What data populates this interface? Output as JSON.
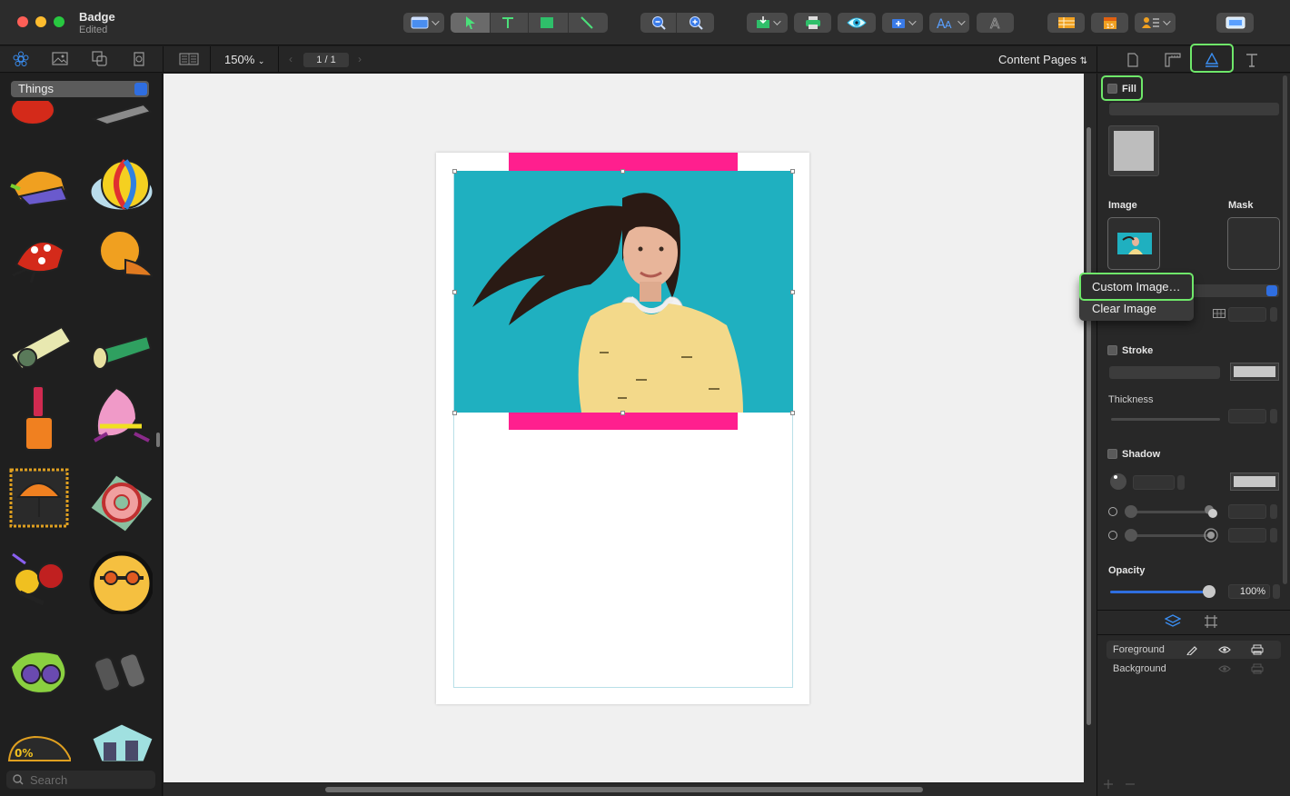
{
  "window": {
    "title": "Badge",
    "subtitle": "Edited"
  },
  "toolbar": {
    "zoom": "150%",
    "page_indicator": "1 / 1",
    "content_pages": "Content Pages"
  },
  "library": {
    "category": "Things",
    "search_placeholder": "Search"
  },
  "inspector": {
    "fill_label": "Fill",
    "image_label": "Image",
    "mask_label": "Mask",
    "stroke_label": "Stroke",
    "thickness_label": "Thickness",
    "shadow_label": "Shadow",
    "opacity_label": "Opacity",
    "opacity_value": "100%",
    "context_menu": [
      "Custom Image…",
      "Clear Image"
    ],
    "layers": [
      "Foreground",
      "Background"
    ]
  },
  "colors": {
    "accent": "#2f6ee0",
    "highlight": "#6fe86a",
    "badge_pink": "#ff1f8e",
    "photo_bg": "#1fb0c0"
  }
}
